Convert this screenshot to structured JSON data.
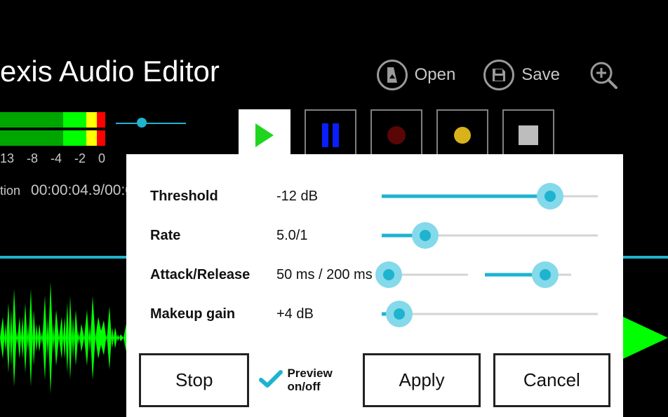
{
  "app": {
    "title": "exis Audio Editor"
  },
  "toolbar": {
    "open_label": "Open",
    "save_label": "Save"
  },
  "meter": {
    "ticks": [
      "13",
      "-8",
      "-4",
      "-2",
      "0"
    ]
  },
  "position": {
    "label": "tion",
    "time": "00:00:04.9/00:00:"
  },
  "transport": {
    "play": "play",
    "pause": "pause",
    "record": "record",
    "mark": "mark",
    "stop": "stop"
  },
  "dialog": {
    "params": {
      "threshold": {
        "label": "Threshold",
        "value": "-12 dB",
        "pos": 78
      },
      "rate": {
        "label": "Rate",
        "value": "5.0/1",
        "pos": 20
      },
      "attack_release": {
        "label": "Attack/Release",
        "value": "50 ms / 200 ms",
        "pos1": 8,
        "pos2": 70
      },
      "makeup_gain": {
        "label": "Makeup gain",
        "value": "+4 dB",
        "pos": 8
      }
    },
    "stop_label": "Stop",
    "preview_label": "Preview on/off",
    "apply_label": "Apply",
    "cancel_label": "Cancel",
    "preview_checked": true
  }
}
